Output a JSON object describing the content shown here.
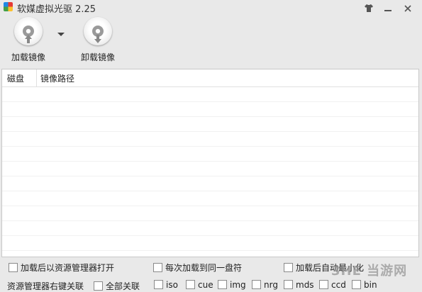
{
  "window": {
    "title": "软媒虚拟光驱 2.25"
  },
  "toolbar": {
    "mount_label": "加载镜像",
    "unmount_label": "卸载镜像"
  },
  "table": {
    "columns": [
      "磁盘",
      "镜像路径"
    ],
    "rows": []
  },
  "options": {
    "open_explorer_after_mount": "加载后以资源管理器打开",
    "same_drive_each_time": "每次加载到同一盘符",
    "auto_minimize_after_mount": "加载后自动最小化"
  },
  "associations": {
    "context_menu": "资源管理器右键关联",
    "all": "全部关联",
    "types": [
      "iso",
      "cue",
      "img",
      "nrg",
      "mds",
      "ccd",
      "bin"
    ]
  },
  "watermark": "3HE 当游网"
}
